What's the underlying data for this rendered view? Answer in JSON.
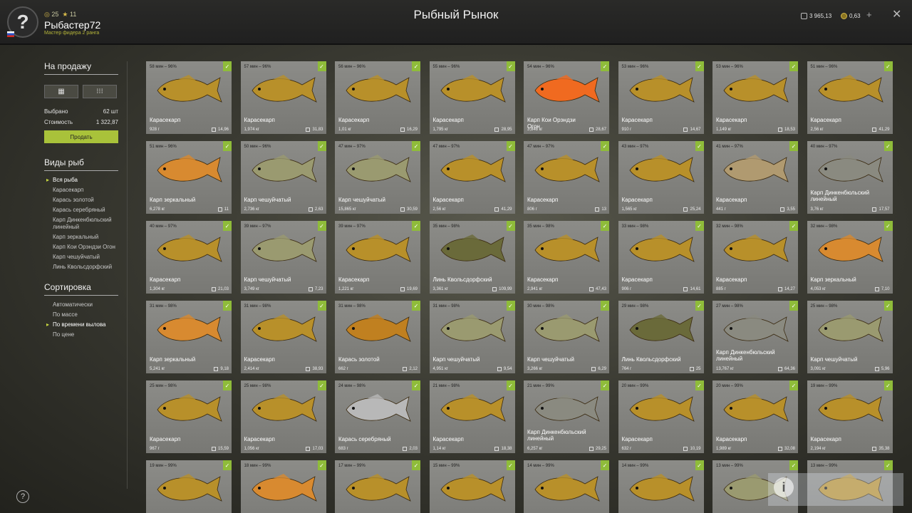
{
  "header": {
    "title": "Рыбный Рынок",
    "username": "Рыбастер72",
    "rank": "Мастер фидера 2 ранга",
    "level": "25",
    "fame": "11",
    "silver": "3 965,13",
    "gold": "0,63",
    "plus": "+",
    "close": "✕",
    "avatar": "?"
  },
  "sidebar": {
    "sale_title": "На продажу",
    "selected_label": "Выбрано",
    "selected_value": "62 шт",
    "cost_label": "Стоимость",
    "cost_value": "1 322,87",
    "sell_button": "Продать",
    "species_title": "Виды рыб",
    "species": [
      "Вся рыба",
      "Карасекарп",
      "Карась золотой",
      "Карась серебряный",
      "Карп Динкенбюльский линейный",
      "Карп зеркальный",
      "Карп Кои Орэндзи Огон",
      "Карп чешуйчатый",
      "Линь Квольсдорфский"
    ],
    "sort_title": "Сортировка",
    "sort": [
      "Автоматически",
      "По массе",
      "По времени вылова",
      "По цене"
    ],
    "help": "?"
  },
  "info": "i",
  "colors": {
    "accent": "#a9c23a",
    "check": "#8fbc3a",
    "card": "#858581"
  },
  "fish": [
    {
      "time": "58 мин – 96%",
      "name": "Карасекарп",
      "weight": "928 г",
      "price": "14,96",
      "color": "#b8902a"
    },
    {
      "time": "57 мин – 96%",
      "name": "Карасекарп",
      "weight": "1,974 кг",
      "price": "31,83",
      "color": "#b8902a"
    },
    {
      "time": "56 мин – 96%",
      "name": "Карасекарп",
      "weight": "1,01 кг",
      "price": "16,29",
      "color": "#b8902a"
    },
    {
      "time": "55 мин – 96%",
      "name": "Карасекарп",
      "weight": "1,795 кг",
      "price": "28,95",
      "color": "#b8902a"
    },
    {
      "time": "54 мин – 96%",
      "name": "Карп Кои Орэндзи Огон",
      "weight": "3,848 кг",
      "price": "28,67",
      "color": "#f06a20"
    },
    {
      "time": "53 мин – 96%",
      "name": "Карасекарп",
      "weight": "910 г",
      "price": "14,67",
      "color": "#b8902a"
    },
    {
      "time": "53 мин – 96%",
      "name": "Карасекарп",
      "weight": "1,149 кг",
      "price": "18,53",
      "color": "#b8902a"
    },
    {
      "time": "51 мин – 96%",
      "name": "Карасекарп",
      "weight": "2,56 кг",
      "price": "41,29",
      "color": "#b8902a"
    },
    {
      "time": "51 мин – 96%",
      "name": "Карп зеркальный",
      "weight": "6,278 кг",
      "price": "11",
      "color": "#d88a30"
    },
    {
      "time": "50 мин – 96%",
      "name": "Карп чешуйчатый",
      "weight": "2,736 кг",
      "price": "2,63",
      "color": "#9a9a70"
    },
    {
      "time": "47 мин – 97%",
      "name": "Карп чешуйчатый",
      "weight": "15,865 кг",
      "price": "30,59",
      "color": "#9a9a70"
    },
    {
      "time": "47 мин – 97%",
      "name": "Карасекарп",
      "weight": "2,56 кг",
      "price": "41,29",
      "color": "#b8902a"
    },
    {
      "time": "47 мин – 97%",
      "name": "Карасекарп",
      "weight": "806 г",
      "price": "13",
      "color": "#b8902a"
    },
    {
      "time": "43 мин – 97%",
      "name": "Карасекарп",
      "weight": "1,565 кг",
      "price": "25,24",
      "color": "#b8902a"
    },
    {
      "time": "41 мин – 97%",
      "name": "Карасекарп",
      "weight": "441 г",
      "price": "3,55",
      "color": "#b09a70"
    },
    {
      "time": "40 мин – 97%",
      "name": "Карп Динкенбюльский линейный",
      "weight": "3,76 кг",
      "price": "17,57",
      "color": "#8a8a80"
    },
    {
      "time": "40 мин – 97%",
      "name": "Карасекарп",
      "weight": "1,304 кг",
      "price": "21,03",
      "color": "#b8902a"
    },
    {
      "time": "39 мин – 97%",
      "name": "Карп чешуйчатый",
      "weight": "3,749 кг",
      "price": "7,23",
      "color": "#9a9a70"
    },
    {
      "time": "39 мин – 97%",
      "name": "Карасекарп",
      "weight": "1,221 кг",
      "price": "19,69",
      "color": "#b8902a"
    },
    {
      "time": "35 мин – 98%",
      "name": "Линь Квольсдорфский",
      "weight": "3,361 кг",
      "price": "109,99",
      "color": "#6a6a3a"
    },
    {
      "time": "35 мин – 98%",
      "name": "Карасекарп",
      "weight": "2,941 кг",
      "price": "47,43",
      "color": "#b8902a"
    },
    {
      "time": "33 мин – 98%",
      "name": "Карасекарп",
      "weight": "906 г",
      "price": "14,61",
      "color": "#b8902a"
    },
    {
      "time": "32 мин – 98%",
      "name": "Карасекарп",
      "weight": "885 г",
      "price": "14,27",
      "color": "#b8902a"
    },
    {
      "time": "32 мин – 98%",
      "name": "Карп зеркальный",
      "weight": "4,053 кг",
      "price": "7,10",
      "color": "#d88a30"
    },
    {
      "time": "31 мин – 98%",
      "name": "Карп зеркальный",
      "weight": "5,241 кг",
      "price": "9,18",
      "color": "#d88a30"
    },
    {
      "time": "31 мин – 98%",
      "name": "Карасекарп",
      "weight": "2,414 кг",
      "price": "38,93",
      "color": "#b8902a"
    },
    {
      "time": "31 мин – 98%",
      "name": "Карась золотой",
      "weight": "662 г",
      "price": "2,12",
      "color": "#c08020"
    },
    {
      "time": "31 мин – 98%",
      "name": "Карп чешуйчатый",
      "weight": "4,951 кг",
      "price": "9,54",
      "color": "#9a9a70"
    },
    {
      "time": "30 мин – 98%",
      "name": "Карп чешуйчатый",
      "weight": "3,266 кг",
      "price": "6,29",
      "color": "#9a9a70"
    },
    {
      "time": "29 мин – 98%",
      "name": "Линь Квольсдорфский",
      "weight": "764 г",
      "price": "25",
      "color": "#6a6a3a"
    },
    {
      "time": "27 мин – 98%",
      "name": "Карп Динкенбюльский линейный",
      "weight": "13,767 кг",
      "price": "64,36",
      "color": "#8a8a80"
    },
    {
      "time": "25 мин – 98%",
      "name": "Карп чешуйчатый",
      "weight": "3,091 кг",
      "price": "5,96",
      "color": "#9a9a70"
    },
    {
      "time": "25 мин – 98%",
      "name": "Карасекарп",
      "weight": "967 г",
      "price": "15,59",
      "color": "#b8902a"
    },
    {
      "time": "25 мин – 98%",
      "name": "Карасекарп",
      "weight": "1,056 кг",
      "price": "17,03",
      "color": "#b8902a"
    },
    {
      "time": "24 мин – 98%",
      "name": "Карась серебряный",
      "weight": "683 г",
      "price": "2,03",
      "color": "#b8b8b8"
    },
    {
      "time": "21 мин – 98%",
      "name": "Карасекарп",
      "weight": "1,14 кг",
      "price": "18,38",
      "color": "#b8902a"
    },
    {
      "time": "21 мин – 99%",
      "name": "Карп Динкенбюльский линейный",
      "weight": "6,257 кг",
      "price": "29,25",
      "color": "#8a8a80"
    },
    {
      "time": "20 мин – 99%",
      "name": "Карасекарп",
      "weight": "632 г",
      "price": "10,19",
      "color": "#b8902a"
    },
    {
      "time": "20 мин – 99%",
      "name": "Карасекарп",
      "weight": "1,989 кг",
      "price": "32,08",
      "color": "#b8902a"
    },
    {
      "time": "19 мин – 99%",
      "name": "Карасекарп",
      "weight": "2,194 кг",
      "price": "35,38",
      "color": "#b8902a"
    },
    {
      "time": "19 мин – 99%",
      "name": "",
      "weight": "",
      "price": "",
      "color": "#b8902a"
    },
    {
      "time": "18 мин – 99%",
      "name": "",
      "weight": "",
      "price": "",
      "color": "#d88a30"
    },
    {
      "time": "17 мин – 99%",
      "name": "",
      "weight": "",
      "price": "",
      "color": "#b8902a"
    },
    {
      "time": "15 мин – 99%",
      "name": "",
      "weight": "",
      "price": "",
      "color": "#b8902a"
    },
    {
      "time": "14 мин – 99%",
      "name": "",
      "weight": "",
      "price": "",
      "color": "#b8902a"
    },
    {
      "time": "14 мин – 99%",
      "name": "",
      "weight": "",
      "price": "",
      "color": "#b8902a"
    },
    {
      "time": "13 мин – 99%",
      "name": "",
      "weight": "",
      "price": "",
      "color": "#9a9a70"
    },
    {
      "time": "13 мин – 99%",
      "name": "",
      "weight": "",
      "price": "",
      "color": "#b8902a"
    }
  ]
}
